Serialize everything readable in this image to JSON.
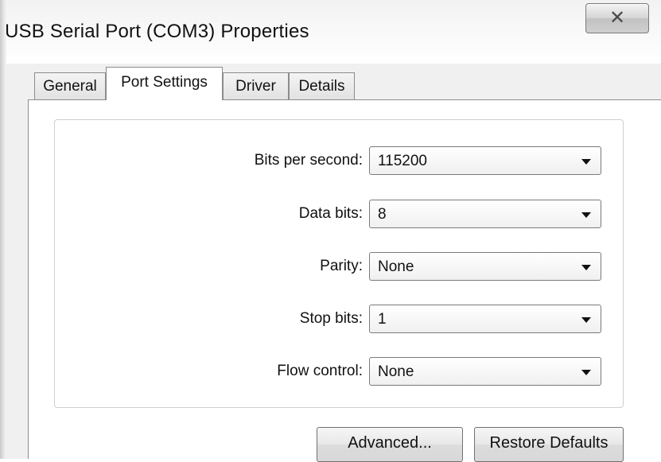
{
  "window": {
    "title": "USB Serial Port (COM3) Properties",
    "close_icon": "close-icon"
  },
  "tabs": [
    {
      "label": "General",
      "active": false
    },
    {
      "label": "Port Settings",
      "active": true
    },
    {
      "label": "Driver",
      "active": false
    },
    {
      "label": "Details",
      "active": false
    }
  ],
  "settings": {
    "bits_per_second": {
      "label": "Bits per second:",
      "value": "115200"
    },
    "data_bits": {
      "label": "Data bits:",
      "value": "8"
    },
    "parity": {
      "label": "Parity:",
      "value": "None"
    },
    "stop_bits": {
      "label": "Stop bits:",
      "value": "1"
    },
    "flow_control": {
      "label": "Flow control:",
      "value": "None"
    }
  },
  "buttons": {
    "advanced": "Advanced...",
    "restore_defaults": "Restore Defaults"
  }
}
